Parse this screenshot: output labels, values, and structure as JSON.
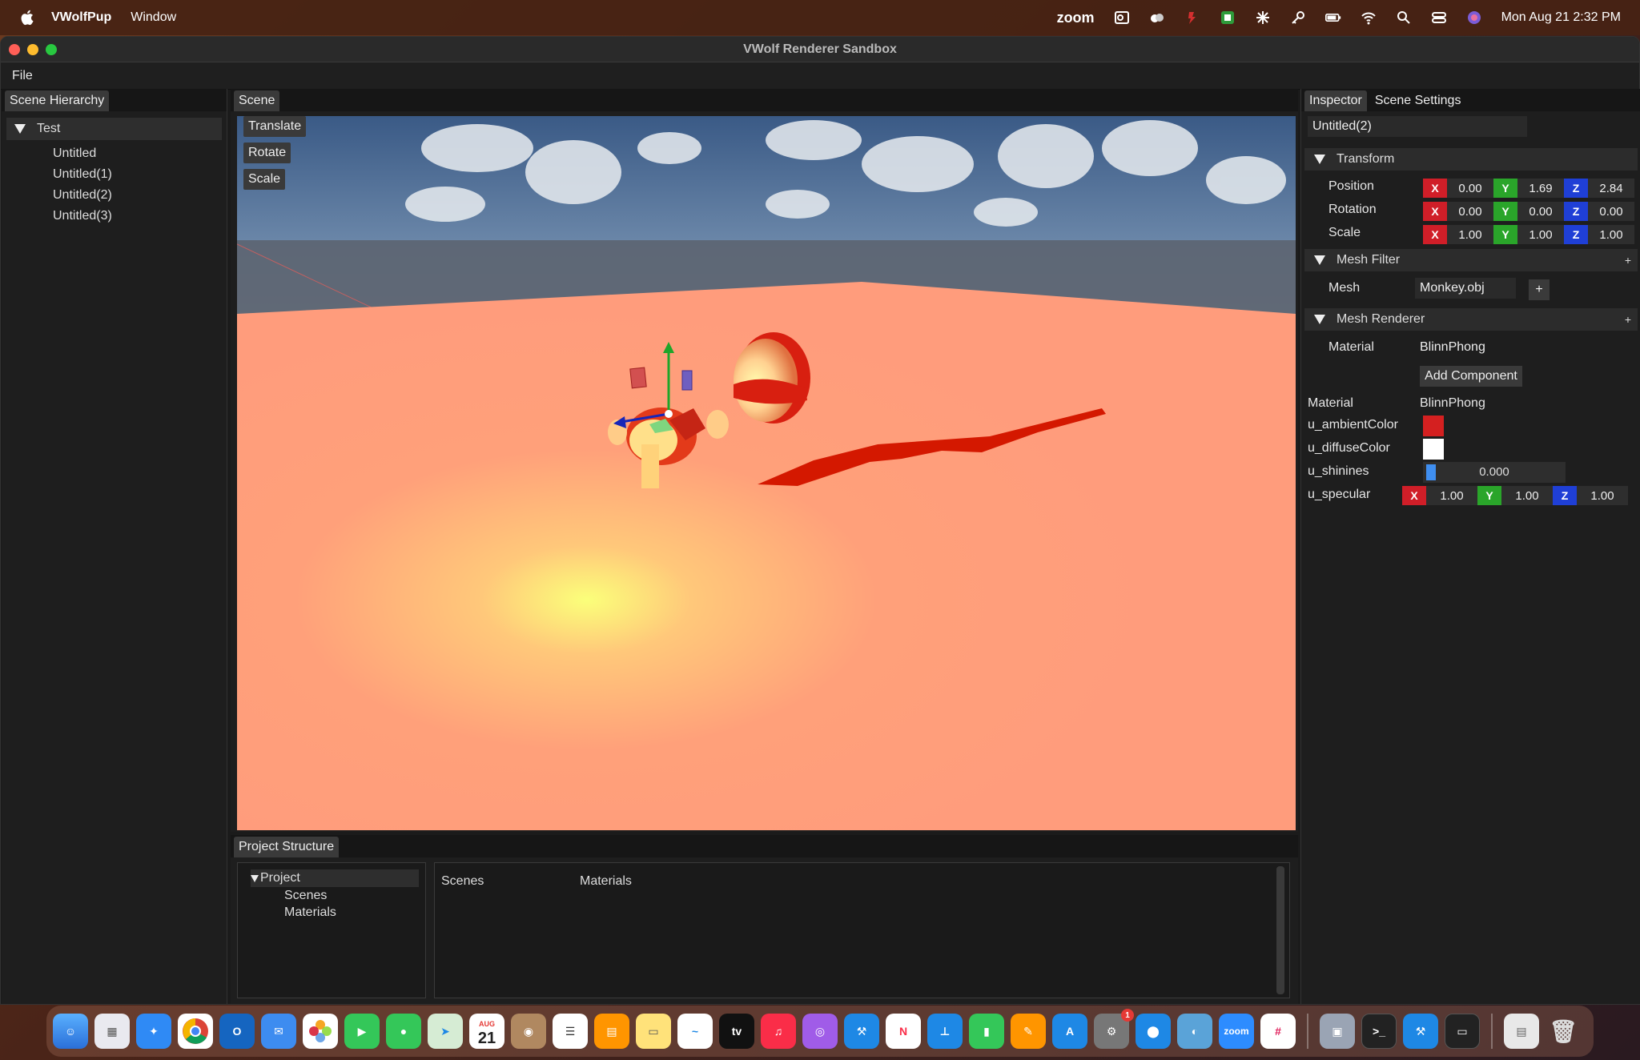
{
  "menubar": {
    "app_name": "VWolfPup",
    "items": [
      "Window"
    ],
    "zoom_label": "zoom",
    "clock": "Mon Aug 21  2:32 PM"
  },
  "window": {
    "title": "VWolf Renderer Sandbox",
    "menu": [
      "File"
    ]
  },
  "hierarchy": {
    "tab": "Scene Hierarchy",
    "root": "Test",
    "items": [
      "Untitled",
      "Untitled(1)",
      "Untitled(2)",
      "Untitled(3)"
    ]
  },
  "scene": {
    "tab": "Scene",
    "tools": [
      "Translate",
      "Rotate",
      "Scale"
    ]
  },
  "project": {
    "tab": "Project Structure",
    "root": "Project",
    "tree_items": [
      "Scenes",
      "Materials"
    ],
    "folders": [
      "Scenes",
      "Materials"
    ]
  },
  "inspector": {
    "tabs": [
      "Inspector",
      "Scene Settings"
    ],
    "entity_name": "Untitled(2)",
    "transform": {
      "title": "Transform",
      "rows": [
        {
          "label": "Position",
          "x": "0.00",
          "y": "1.69",
          "z": "2.84"
        },
        {
          "label": "Rotation",
          "x": "0.00",
          "y": "0.00",
          "z": "0.00"
        },
        {
          "label": "Scale",
          "x": "1.00",
          "y": "1.00",
          "z": "1.00"
        }
      ]
    },
    "mesh_filter": {
      "title": "Mesh Filter",
      "plus": "+",
      "mesh_label": "Mesh",
      "mesh_value": "Monkey.obj",
      "button": "+"
    },
    "mesh_renderer": {
      "title": "Mesh Renderer",
      "plus": "+",
      "material_label": "Material",
      "material_value": "BlinnPhong"
    },
    "add_component": "Add Component",
    "material": {
      "label": "Material",
      "value": "BlinnPhong",
      "ambient_label": "u_ambientColor",
      "ambient_color": "#d42020",
      "diffuse_label": "u_diffuseColor",
      "diffuse_color": "#ffffff",
      "shininess_label": "u_shinines",
      "shininess_value": "0.000",
      "specular_label": "u_specular",
      "specular": {
        "x": "1.00",
        "y": "1.00",
        "z": "1.00"
      }
    },
    "axis_labels": {
      "x": "X",
      "y": "Y",
      "z": "Z"
    }
  },
  "dock": {
    "calendar_month": "AUG",
    "calendar_day": "21",
    "tv_label": "tv",
    "zoom_label": "zoom",
    "badge_count": "1"
  }
}
